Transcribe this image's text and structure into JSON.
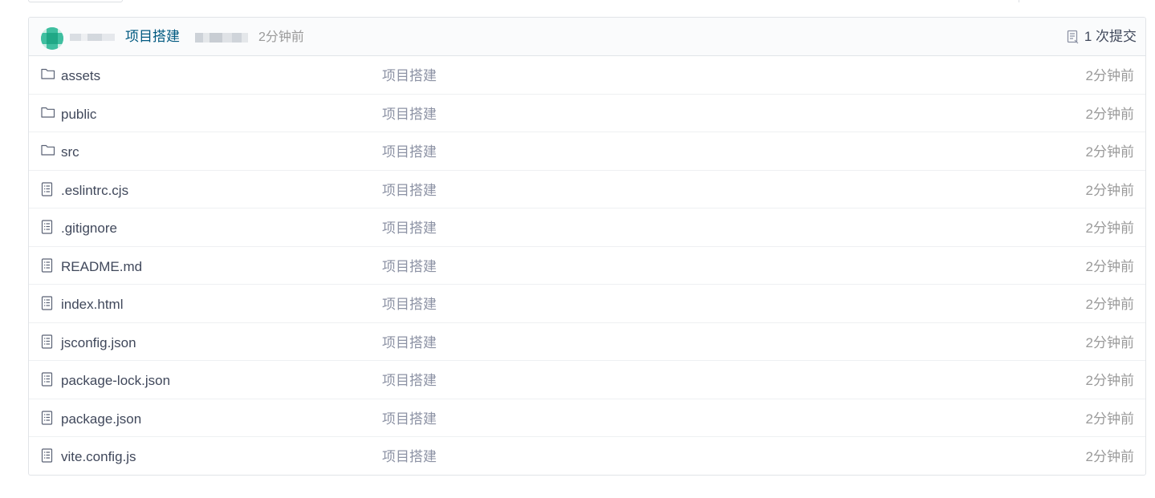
{
  "header": {
    "commit_message": "项目搭建",
    "commit_time": "2分钟前",
    "commit_count": "1 次提交",
    "icons": {
      "commit_count": "commit-history-icon"
    }
  },
  "files": [
    {
      "name": "assets",
      "type": "folder",
      "message": "项目搭建",
      "time": "2分钟前"
    },
    {
      "name": "public",
      "type": "folder",
      "message": "项目搭建",
      "time": "2分钟前"
    },
    {
      "name": "src",
      "type": "folder",
      "message": "项目搭建",
      "time": "2分钟前"
    },
    {
      "name": ".eslintrc.cjs",
      "type": "file",
      "message": "项目搭建",
      "time": "2分钟前"
    },
    {
      "name": ".gitignore",
      "type": "file",
      "message": "项目搭建",
      "time": "2分钟前"
    },
    {
      "name": "README.md",
      "type": "file",
      "message": "项目搭建",
      "time": "2分钟前"
    },
    {
      "name": "index.html",
      "type": "file",
      "message": "项目搭建",
      "time": "2分钟前"
    },
    {
      "name": "jsconfig.json",
      "type": "file",
      "message": "项目搭建",
      "time": "2分钟前"
    },
    {
      "name": "package-lock.json",
      "type": "file",
      "message": "项目搭建",
      "time": "2分钟前"
    },
    {
      "name": "package.json",
      "type": "file",
      "message": "项目搭建",
      "time": "2分钟前"
    },
    {
      "name": "vite.config.js",
      "type": "file",
      "message": "项目搭建",
      "time": "2分钟前"
    }
  ],
  "colors": {
    "link": "#005980",
    "text": "#40485b",
    "muted": "#8c92a4",
    "time": "#9a9a9a",
    "border": "#e1e4e8",
    "header_bg": "#fafbfc"
  }
}
